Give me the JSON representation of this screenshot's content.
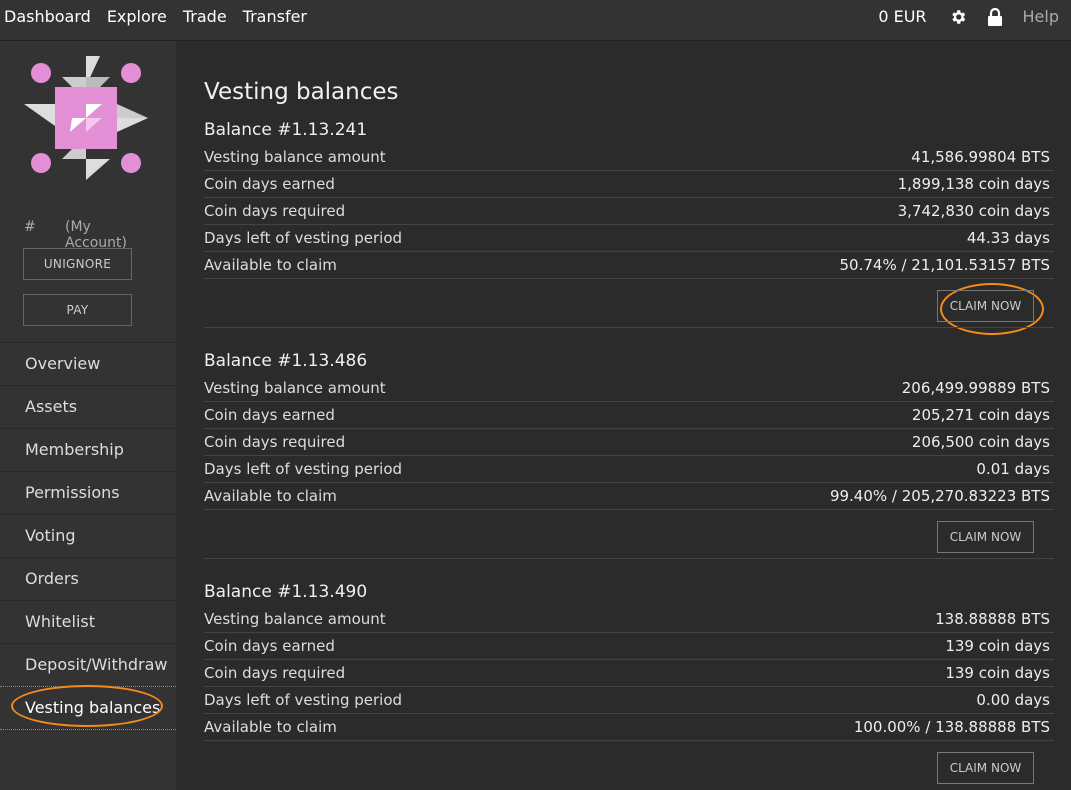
{
  "topbar": {
    "nav": [
      "Dashboard",
      "Explore",
      "Trade",
      "Transfer"
    ],
    "balance": "0 EUR",
    "settings_icon": "gear-icon",
    "lock_icon": "lock-icon",
    "help": "Help"
  },
  "sidebar": {
    "account_hash": "#",
    "account_name": "(My Account)",
    "unignore_label": "UNIGNORE",
    "pay_label": "PAY",
    "menu": [
      "Overview",
      "Assets",
      "Membership",
      "Permissions",
      "Voting",
      "Orders",
      "Whitelist",
      "Deposit/Withdraw",
      "Vesting balances"
    ],
    "active_index": 8,
    "avatar_colors": {
      "pink": "#e28fd6",
      "gray": "#cccccc",
      "bg": "#ffffff"
    }
  },
  "main": {
    "title": "Vesting balances",
    "balances": [
      {
        "title": "Balance #1.13.241",
        "rows": [
          {
            "label": "Vesting balance amount",
            "value": "41,586.99804 BTS"
          },
          {
            "label": "Coin days earned",
            "value": "1,899,138 coin days"
          },
          {
            "label": "Coin days required",
            "value": "3,742,830 coin days"
          },
          {
            "label": "Days left of vesting period",
            "value": "44.33 days"
          },
          {
            "label": "Available to claim",
            "value": "50.74% / 21,101.53157 BTS"
          }
        ],
        "claim_label": "CLAIM NOW"
      },
      {
        "title": "Balance #1.13.486",
        "rows": [
          {
            "label": "Vesting balance amount",
            "value": "206,499.99889 BTS"
          },
          {
            "label": "Coin days earned",
            "value": "205,271 coin days"
          },
          {
            "label": "Coin days required",
            "value": "206,500 coin days"
          },
          {
            "label": "Days left of vesting period",
            "value": "0.01 days"
          },
          {
            "label": "Available to claim",
            "value": "99.40% / 205,270.83223 BTS"
          }
        ],
        "claim_label": "CLAIM NOW"
      },
      {
        "title": "Balance #1.13.490",
        "rows": [
          {
            "label": "Vesting balance amount",
            "value": "138.88888 BTS"
          },
          {
            "label": "Coin days earned",
            "value": "139 coin days"
          },
          {
            "label": "Coin days required",
            "value": "139 coin days"
          },
          {
            "label": "Days left of vesting period",
            "value": "0.00 days"
          },
          {
            "label": "Available to claim",
            "value": "100.00% / 138.88888 BTS"
          }
        ],
        "claim_label": "CLAIM NOW"
      }
    ]
  },
  "highlight_color": "#f28a1c"
}
